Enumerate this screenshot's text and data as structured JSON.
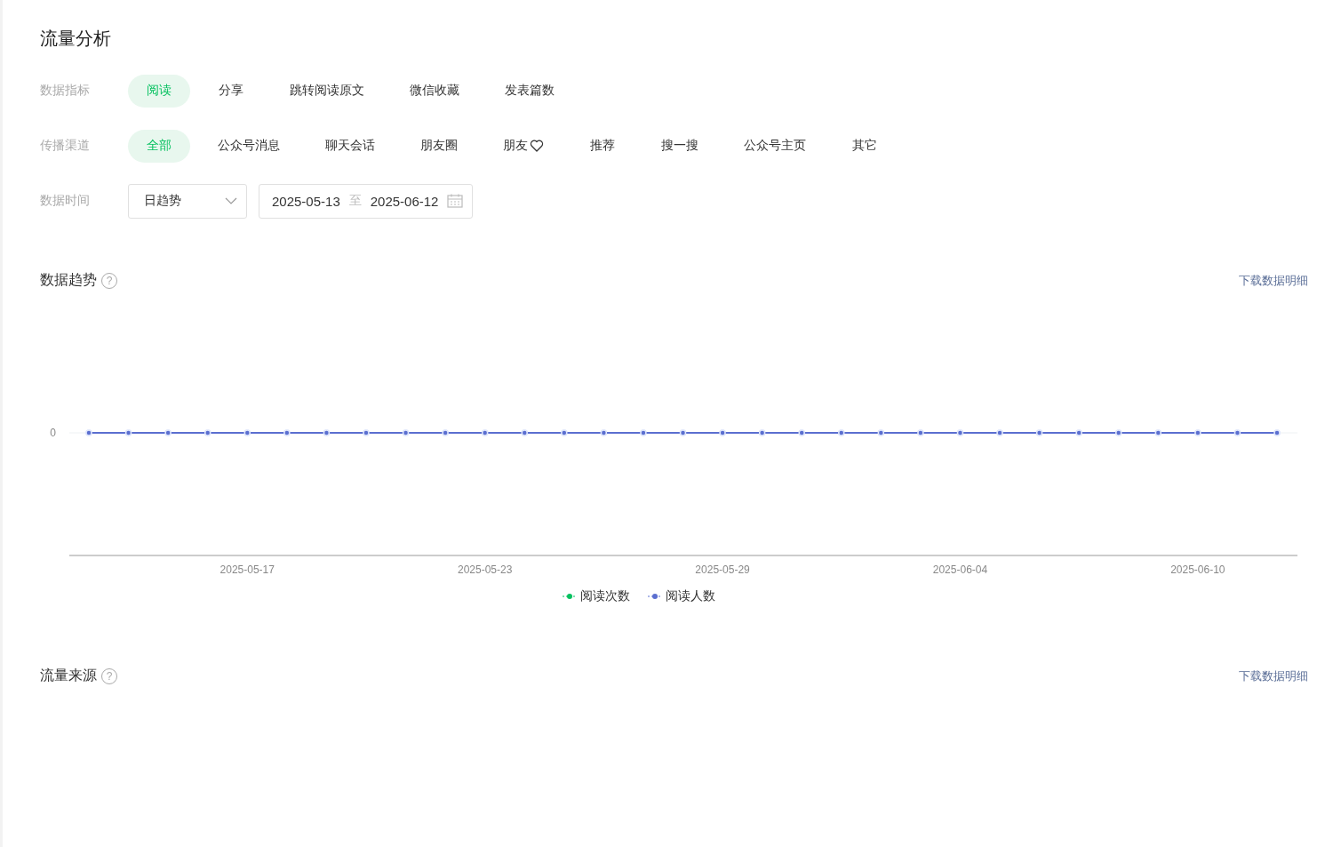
{
  "title": "流量分析",
  "filters": [
    {
      "kind": "pills",
      "label": "数据指标",
      "options": [
        {
          "label": "阅读",
          "selected": true
        },
        {
          "label": "分享",
          "selected": false
        },
        {
          "label": "跳转阅读原文",
          "selected": false
        },
        {
          "label": "微信收藏",
          "selected": false
        },
        {
          "label": "发表篇数",
          "selected": false
        }
      ]
    },
    {
      "kind": "pills",
      "label": "传播渠道",
      "options": [
        {
          "label": "全部",
          "selected": true
        },
        {
          "label": "公众号消息",
          "selected": false
        },
        {
          "label": "聊天会话",
          "selected": false
        },
        {
          "label": "朋友圈",
          "selected": false
        },
        {
          "label": "朋友",
          "selected": false,
          "heart": true
        },
        {
          "label": "推荐",
          "selected": false
        },
        {
          "label": "搜一搜",
          "selected": false
        },
        {
          "label": "公众号主页",
          "selected": false
        },
        {
          "label": "其它",
          "selected": false
        }
      ]
    },
    {
      "kind": "time",
      "label": "数据时间",
      "select": "日趋势",
      "start": "2025-05-13",
      "separator": "至",
      "end": "2025-06-12"
    }
  ],
  "sections": [
    {
      "title": "数据趋势",
      "help": "?",
      "link": "下载数据明细",
      "trend": {
        "y_label": "0",
        "x_labels": [
          "2025-05-17",
          "2025-05-23",
          "2025-05-29",
          "2025-06-04",
          "2025-06-10"
        ],
        "legend": [
          {
            "name": "阅读次数",
            "color": "#07c160"
          },
          {
            "name": "阅读人数",
            "color": "#5b6fd0"
          }
        ]
      }
    },
    {
      "title": "流量来源",
      "help": "?",
      "link": "下载数据明细"
    }
  ]
}
